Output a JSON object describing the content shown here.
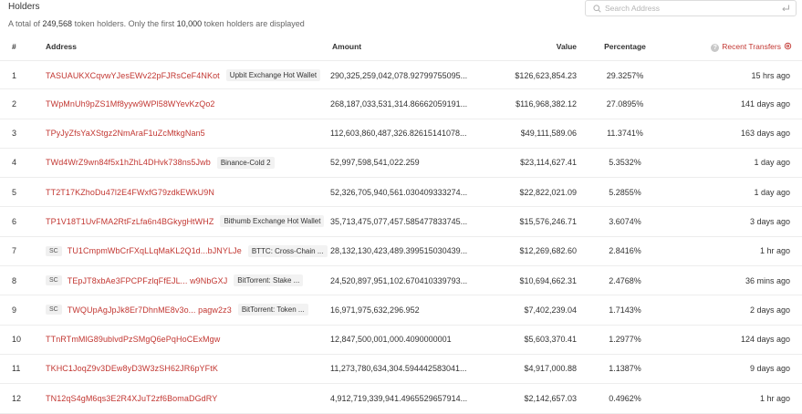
{
  "header": {
    "title": "Holders",
    "summary_prefix": "A total of ",
    "total_holders": "249,568",
    "summary_middle": " token holders. Only the first ",
    "first_n": "10,000",
    "summary_suffix": " token holders are displayed"
  },
  "search": {
    "placeholder": "Search Address",
    "icon": "search-icon",
    "enter_icon": "enter-icon"
  },
  "table": {
    "columns": {
      "index": "#",
      "address": "Address",
      "amount": "Amount",
      "value": "Value",
      "percentage": "Percentage",
      "recent_transfers": "Recent Transfers",
      "help_icon": "?",
      "settings_icon": "gear-icon"
    },
    "rows": [
      {
        "idx": "1",
        "sc": "",
        "address": "TASUAUKXCqvwYJesEWv22pFJRsCeF4NKot",
        "tag": "Upbit Exchange Hot Wallet",
        "amount": "290,325,259,042,078.92799755095...",
        "value": "$126,623,854.23",
        "percentage": "29.3257%",
        "transfer": "15 hrs ago"
      },
      {
        "idx": "2",
        "sc": "",
        "address": "TWpMnUh9pZS1Mf8yyw9WPl58WYevKzQo2",
        "tag": "",
        "amount": "268,187,033,531,314.86662059191...",
        "value": "$116,968,382.12",
        "percentage": "27.0895%",
        "transfer": "141 days ago"
      },
      {
        "idx": "3",
        "sc": "",
        "address": "TPyJyZfsYaXStgz2NmAraF1uZcMtkgNan5",
        "tag": "",
        "amount": "112,603,860,487,326.82615141078...",
        "value": "$49,111,589.06",
        "percentage": "11.3741%",
        "transfer": "163 days ago"
      },
      {
        "idx": "4",
        "sc": "",
        "address": "TWd4WrZ9wn84f5x1hZhL4DHvk738ns5Jwb",
        "tag": "Binance-Cold 2",
        "amount": "52,997,598,541,022.259",
        "value": "$23,114,627.41",
        "percentage": "5.3532%",
        "transfer": "1 day ago"
      },
      {
        "idx": "5",
        "sc": "",
        "address": "TT2T17KZhoDu47l2E4FWxfG79zdkEWkU9N",
        "tag": "",
        "amount": "52,326,705,940,561.030409333274...",
        "value": "$22,822,021.09",
        "percentage": "5.2855%",
        "transfer": "1 day ago"
      },
      {
        "idx": "6",
        "sc": "",
        "address": "TP1V18T1UvFMA2RtFzLfa6n4BGkygHtWHZ",
        "tag": "Bithumb Exchange Hot Wallet",
        "amount": "35,713,475,077,457.585477833745...",
        "value": "$15,576,246.71",
        "percentage": "3.6074%",
        "transfer": "3 days ago"
      },
      {
        "idx": "7",
        "sc": "SC",
        "address": "TU1CmpmWbCrFXqLLqMaKL2Q1d...bJNYLJe",
        "tag": "BTTC: Cross-Chain ...",
        "amount": "28,132,130,423,489.399515030439...",
        "value": "$12,269,682.60",
        "percentage": "2.8416%",
        "transfer": "1 hr ago"
      },
      {
        "idx": "8",
        "sc": "SC",
        "address": "TEpJT8xbAe3FPCPFzlqFfEJL... w9NbGXJ",
        "tag": "BitTorrent: Stake ...",
        "amount": "24,520,897,951,102.670410339793...",
        "value": "$10,694,662.31",
        "percentage": "2.4768%",
        "transfer": "36 mins ago"
      },
      {
        "idx": "9",
        "sc": "SC",
        "address": "TWQUpAgJpJk8Er7DhnME8v3o... pagw2z3",
        "tag": "BitTorrent: Token ...",
        "amount": "16,971,975,632,296.952",
        "value": "$7,402,239.04",
        "percentage": "1.7143%",
        "transfer": "2 days ago"
      },
      {
        "idx": "10",
        "sc": "",
        "address": "TTnRTmMlG89ublvdPzSMgQ6ePqHoCExMgw",
        "tag": "",
        "amount": "12,847,500,001,000.4090000001",
        "value": "$5,603,370.41",
        "percentage": "1.2977%",
        "transfer": "124 days ago"
      },
      {
        "idx": "11",
        "sc": "",
        "address": "TKHC1JoqZ9v3DEw8yD3W3zSH62JR6pYFtK",
        "tag": "",
        "amount": "11,273,780,634,304.594442583041...",
        "value": "$4,917,000.88",
        "percentage": "1.1387%",
        "transfer": "9 days ago"
      },
      {
        "idx": "12",
        "sc": "",
        "address": "TN12qS4gM6qs3E2R4XJuT2zf6BomaDGdRY",
        "tag": "",
        "amount": "4,912,719,339,941.4965529657914...",
        "value": "$2,142,657.03",
        "percentage": "0.4962%",
        "transfer": "1 hr ago"
      }
    ]
  },
  "colors": {
    "accent": "#c23631",
    "text": "#333333",
    "muted": "#666666",
    "border": "#ededed",
    "tag_bg": "#f2f2f2"
  }
}
